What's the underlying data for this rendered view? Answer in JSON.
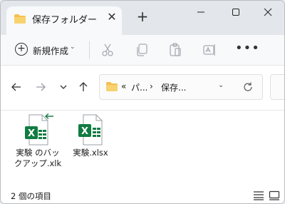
{
  "tab": {
    "title": "保存フォルダー",
    "close_icon": "close-icon",
    "new_tab_icon": "plus-icon"
  },
  "window_controls": [
    "minimize-icon",
    "maximize-icon",
    "close-icon"
  ],
  "toolbar": {
    "new_label": "新規作成",
    "actions": [
      "cut-icon",
      "copy-icon",
      "paste-icon",
      "rename-icon",
      "more-icon"
    ]
  },
  "address": {
    "overflow": "«",
    "segments": [
      "パ...",
      "保存..."
    ],
    "separator": "›",
    "nav_icons": [
      "back-icon",
      "forward-icon",
      "recent-icon",
      "up-icon"
    ]
  },
  "files": [
    {
      "name": "実験 のバックアップ.xlk",
      "type": "excel-backup-icon"
    },
    {
      "name": "実験.xlsx",
      "type": "excel-icon"
    }
  ],
  "status": {
    "item_count": "2 個の項目"
  },
  "colors": {
    "excel_green": "#107c41",
    "folder_yellow": "#f4c04e",
    "backup_arrow": "#1f7a4d"
  }
}
